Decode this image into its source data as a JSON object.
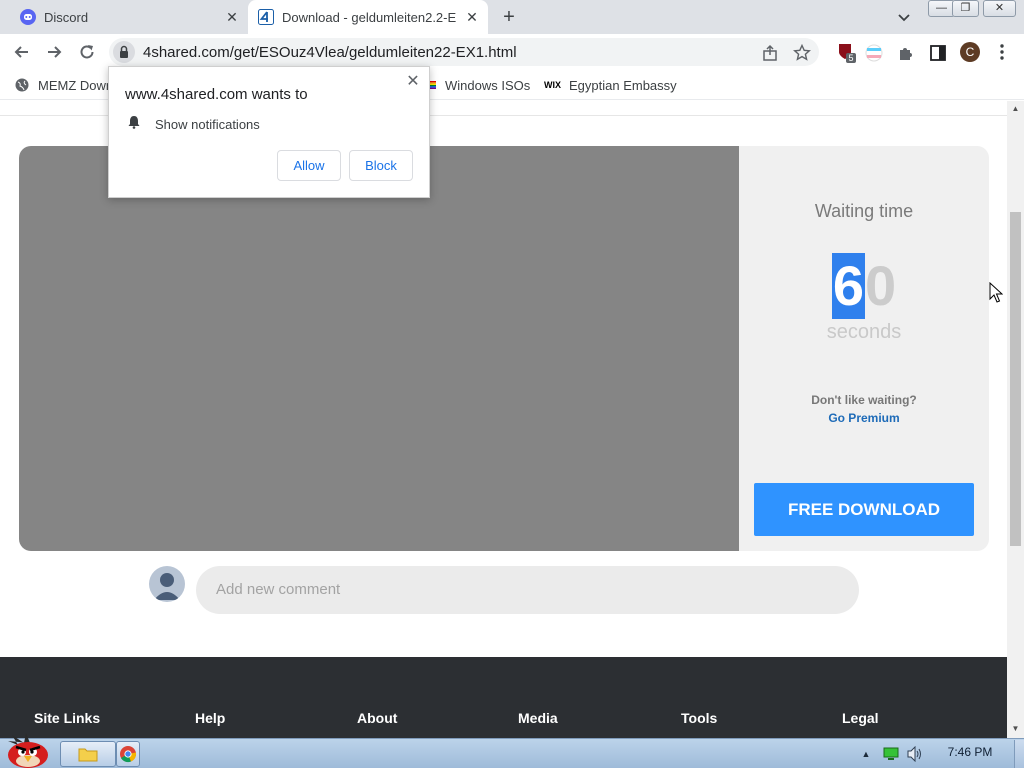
{
  "tabs": [
    {
      "title": "Discord",
      "icon": "discord-icon",
      "active": false
    },
    {
      "title": "Download - geldumleiten2.2-E",
      "icon": "4shared-icon",
      "active": true
    }
  ],
  "toolbar": {
    "url": "4shared.com/get/ESOuz4Vlea/geldumleiten22-EX1.html",
    "extension_badge": "5",
    "profile_initial": "C"
  },
  "bookmarks": [
    {
      "label": "MEMZ Down",
      "icon": "globe-icon"
    },
    {
      "label": "Windows ISOs",
      "icon": "rainbow-flag-icon"
    },
    {
      "label": "Egyptian Embassy",
      "icon": "wix-icon"
    }
  ],
  "wix_mark": "WIX",
  "notification_popup": {
    "title": "www.4shared.com wants to",
    "permission": "Show notifications",
    "allow_label": "Allow",
    "block_label": "Block"
  },
  "download_panel": {
    "waiting_label": "Waiting time",
    "countdown_first": "6",
    "countdown_rest": "0",
    "seconds_label": "seconds",
    "dont_like": "Don't like waiting?",
    "go_premium": "Go Premium",
    "free_download": "FREE DOWNLOAD"
  },
  "comment": {
    "placeholder": "Add new comment"
  },
  "footer_links": [
    "Site Links",
    "Help",
    "About",
    "Media",
    "Tools",
    "Legal"
  ],
  "taskbar": {
    "clock": "7:46 PM"
  },
  "colors": {
    "download_button": "#2f93ff",
    "premium_link": "#1e6bb8",
    "footer_bg": "#2c2f33",
    "selection": "#2f80ed"
  }
}
